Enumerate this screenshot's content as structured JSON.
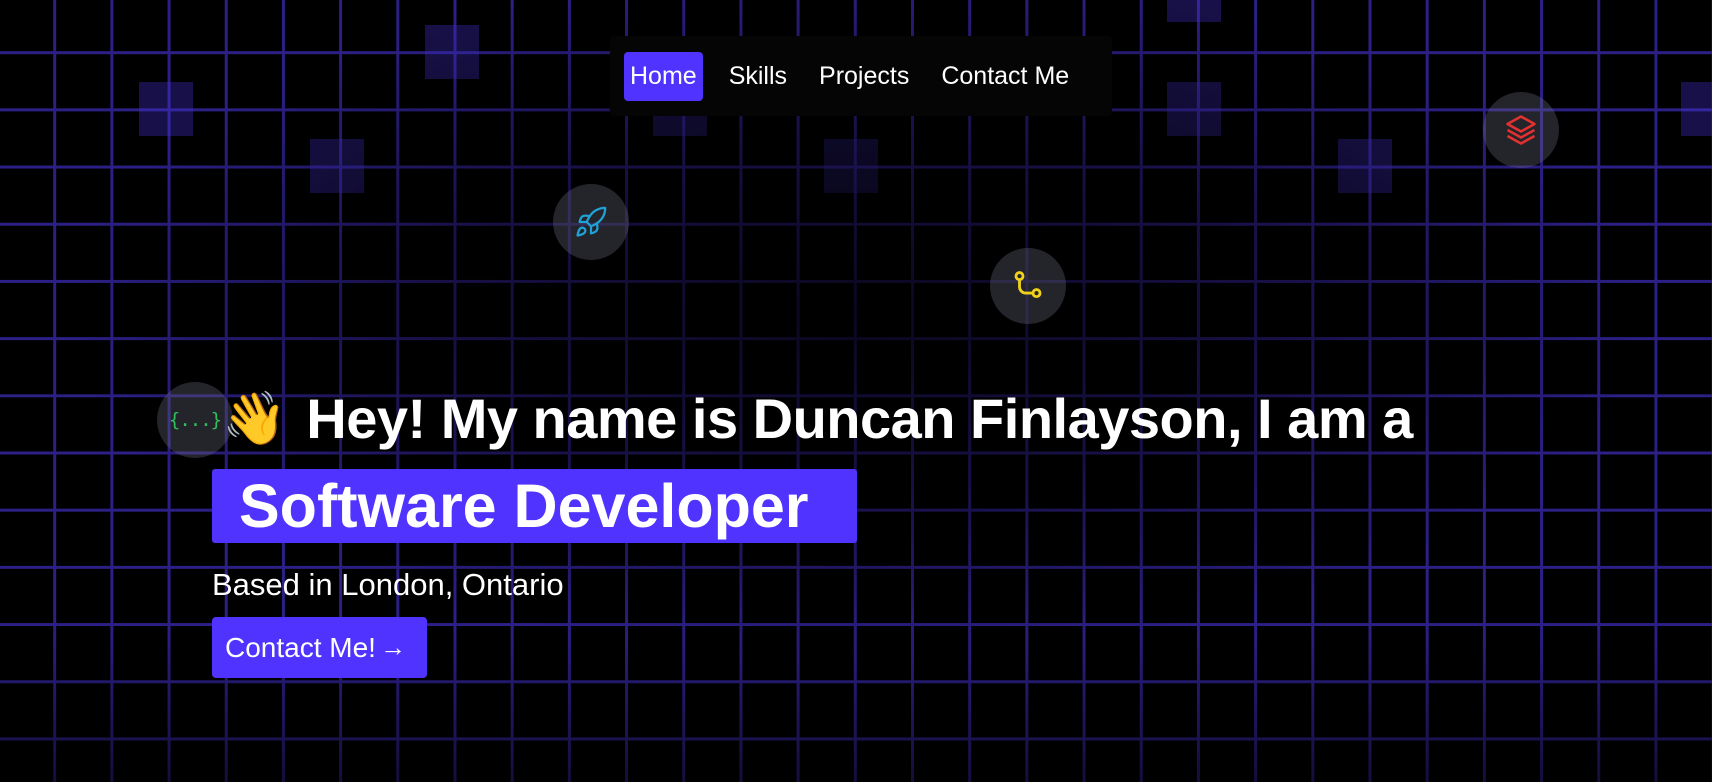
{
  "nav": {
    "items": [
      {
        "label": "Home",
        "active": true
      },
      {
        "label": "Skills",
        "active": false
      },
      {
        "label": "Projects",
        "active": false
      },
      {
        "label": "Contact Me",
        "active": false
      }
    ]
  },
  "hero": {
    "wave_emoji": "👋",
    "intro": "Hey! My name is Duncan Finlayson, I am a",
    "role": "Software Developer",
    "location": "Based in London, Ontario",
    "cta_label": "Contact Me!",
    "cta_arrow": "→"
  },
  "floating_icons": [
    {
      "name": "rocket-icon",
      "color": "#1fa3d6"
    },
    {
      "name": "git-branch-icon",
      "color": "#f0d21b"
    },
    {
      "name": "layers-icon",
      "color": "#e2312e"
    },
    {
      "name": "code-braces-icon",
      "color": "#2fc05b",
      "text": "{...}"
    }
  ],
  "colors": {
    "accent": "#5033ff",
    "grid": "#2c1f86",
    "background": "#000000"
  }
}
